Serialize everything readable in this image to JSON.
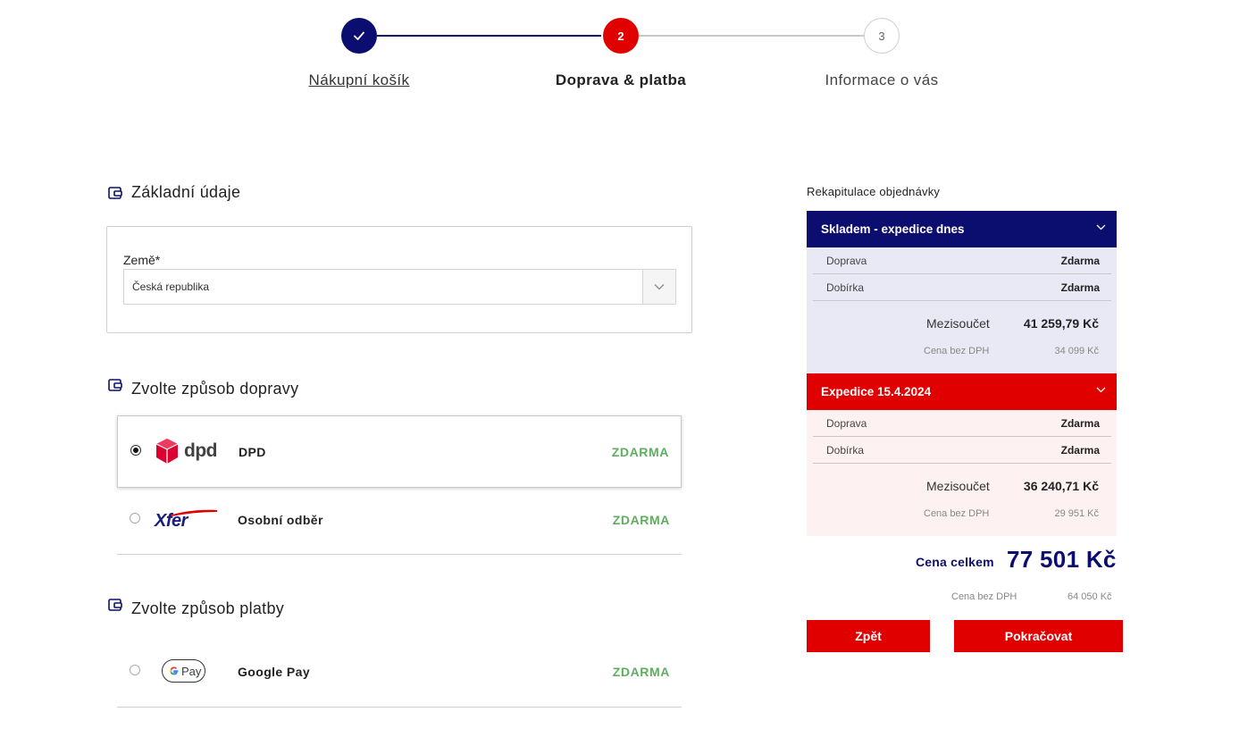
{
  "stepper": {
    "steps": [
      {
        "number": "",
        "label": "Nákupní košík"
      },
      {
        "number": "2",
        "label": "Doprava & platba"
      },
      {
        "number": "3",
        "label": "Informace o vás"
      }
    ]
  },
  "basic": {
    "title": "Základní údaje",
    "country_label": "Země*",
    "country_value": "Česká republika"
  },
  "shipping": {
    "title": "Zvolte způsob dopravy",
    "options": [
      {
        "name": "DPD",
        "price": "ZDARMA",
        "logo_text": "dpd",
        "selected": true
      },
      {
        "name": "Osobní odběr",
        "price": "ZDARMA",
        "logo_text": "Xfer",
        "selected": false
      }
    ]
  },
  "payment": {
    "title": "Zvolte způsob platby",
    "options": [
      {
        "name": "Google Pay",
        "price": "ZDARMA",
        "logo_text": "Pay",
        "selected": false
      }
    ]
  },
  "summary": {
    "title": "Rekapitulace objednávky",
    "shipments": [
      {
        "header": "Skladem - expedice dnes",
        "header_color": "#0b0e6e",
        "body_color": "#e9e9f5",
        "rows": [
          {
            "key": "Doprava",
            "value": "Zdarma"
          },
          {
            "key": "Dobírka",
            "value": "Zdarma"
          }
        ],
        "subtotal_label": "Mezisoučet",
        "subtotal_value": "41 259,79 Kč",
        "net_label": "Cena bez DPH",
        "net_value": "34 099 Kč"
      },
      {
        "header": "Expedice 15.4.2024",
        "header_color": "#e00000",
        "body_color": "#fdf1f1",
        "rows": [
          {
            "key": "Doprava",
            "value": "Zdarma"
          },
          {
            "key": "Dobírka",
            "value": "Zdarma"
          }
        ],
        "subtotal_label": "Mezisoučet",
        "subtotal_value": "36 240,71 Kč",
        "net_label": "Cena bez DPH",
        "net_value": "29 951 Kč"
      }
    ],
    "total_label": "Cena celkem",
    "total_value": "77 501 Kč",
    "total_net_label": "Cena bez DPH",
    "total_net_value": "64 050 Kč"
  },
  "buttons": {
    "back": "Zpět",
    "continue": "Pokračovat"
  },
  "colors": {
    "navy": "#0b0e6e",
    "red": "#e00000",
    "free_green": "#5fae5f",
    "dpd_red": "#dc0032",
    "xfer_navy": "#1a1f7a"
  }
}
